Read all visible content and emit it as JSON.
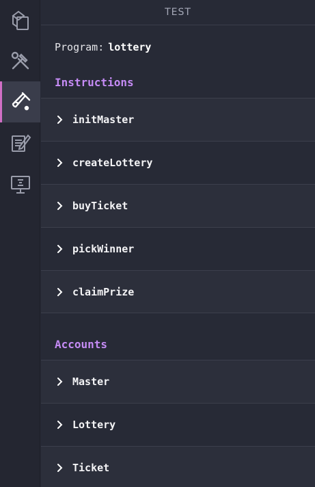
{
  "panel": {
    "title": "TEST"
  },
  "program": {
    "label": "Program:",
    "value": "lottery"
  },
  "instructions": {
    "title": "Instructions",
    "items": [
      {
        "label": "initMaster"
      },
      {
        "label": "createLottery"
      },
      {
        "label": "buyTicket"
      },
      {
        "label": "pickWinner"
      },
      {
        "label": "claimPrize"
      }
    ]
  },
  "accounts": {
    "title": "Accounts",
    "items": [
      {
        "label": "Master"
      },
      {
        "label": "Lottery"
      },
      {
        "label": "Ticket"
      }
    ]
  },
  "activity_bar": {
    "items": [
      {
        "icon": "files-icon"
      },
      {
        "icon": "tools-icon"
      },
      {
        "icon": "test-tube-icon",
        "active": true
      },
      {
        "icon": "edit-document-icon"
      },
      {
        "icon": "deploy-monitor-icon"
      }
    ]
  },
  "colors": {
    "accent": "#c58bf5",
    "active_indicator": "#d06fc6"
  }
}
